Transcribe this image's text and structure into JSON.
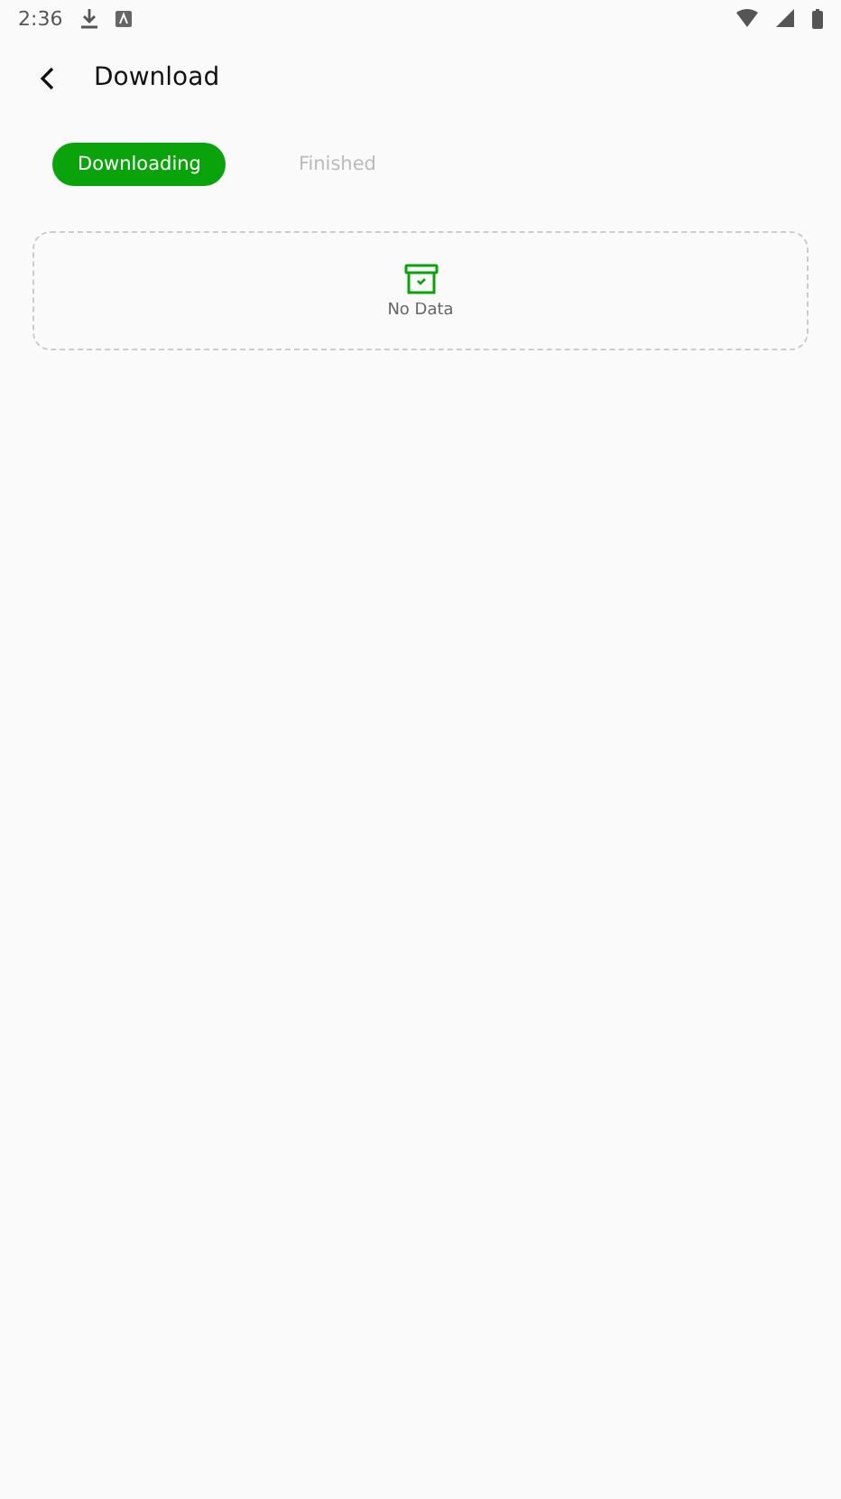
{
  "status_bar": {
    "time": "2:36"
  },
  "header": {
    "title": "Download"
  },
  "tabs": [
    {
      "label": "Downloading",
      "selected": true
    },
    {
      "label": "Finished",
      "selected": false
    }
  ],
  "empty_state": {
    "message": "No Data"
  }
}
